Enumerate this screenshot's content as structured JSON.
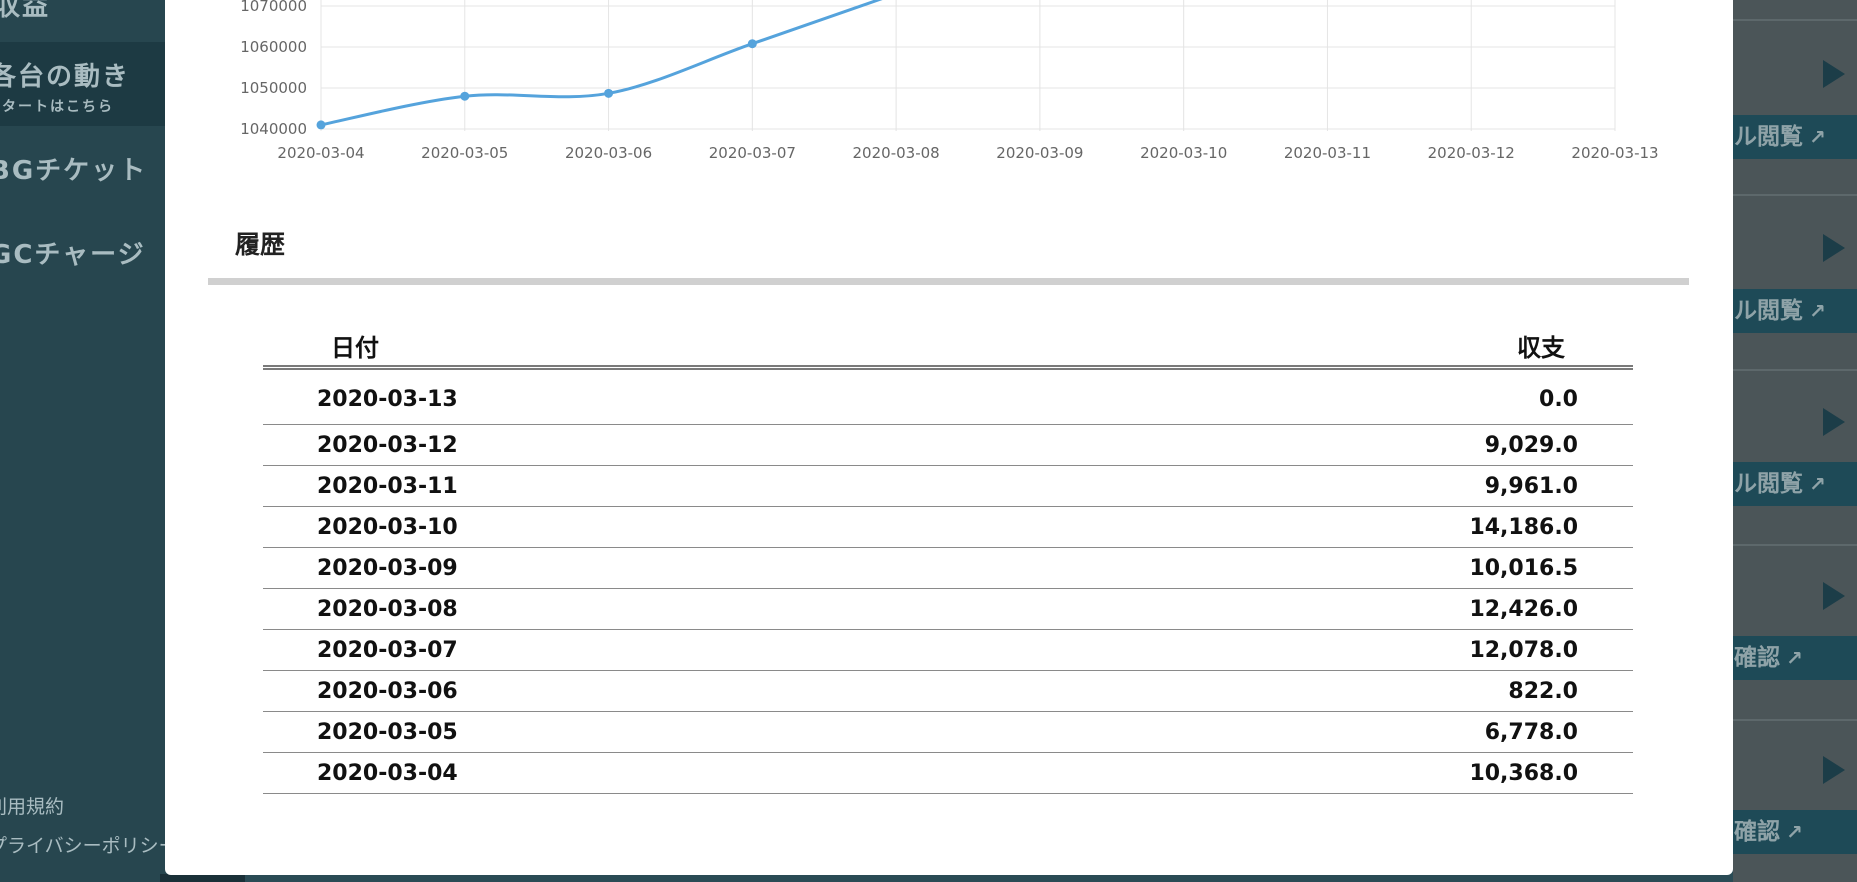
{
  "sidebar": {
    "items": [
      {
        "label": "収益"
      },
      {
        "label": "各台の動き",
        "sub": "スタートはこちら"
      },
      {
        "label": "BGチケット"
      },
      {
        "label": "GCチャージ"
      }
    ],
    "footer": [
      {
        "label": "利用規約"
      },
      {
        "label": "プライバシーポリシー"
      }
    ]
  },
  "background_list": {
    "buttons": [
      {
        "label": "ル閲覧"
      },
      {
        "label": "ル閲覧"
      },
      {
        "label": "ル閲覧"
      },
      {
        "label": "確認"
      },
      {
        "label": "確認"
      }
    ]
  },
  "modal": {
    "history_title": "履歴",
    "table": {
      "headers": {
        "date": "日付",
        "amount": "収支"
      },
      "rows": [
        {
          "date": "2020-03-13",
          "amount": "0.0"
        },
        {
          "date": "2020-03-12",
          "amount": "9,029.0"
        },
        {
          "date": "2020-03-11",
          "amount": "9,961.0"
        },
        {
          "date": "2020-03-10",
          "amount": "14,186.0"
        },
        {
          "date": "2020-03-09",
          "amount": "10,016.5"
        },
        {
          "date": "2020-03-08",
          "amount": "12,426.0"
        },
        {
          "date": "2020-03-07",
          "amount": "12,078.0"
        },
        {
          "date": "2020-03-06",
          "amount": "822.0"
        },
        {
          "date": "2020-03-05",
          "amount": "6,778.0"
        },
        {
          "date": "2020-03-04",
          "amount": "10,368.0"
        }
      ]
    }
  },
  "chart_data": {
    "type": "line",
    "x": [
      "2020-03-04",
      "2020-03-05",
      "2020-03-06",
      "2020-03-07",
      "2020-03-08",
      "2020-03-09",
      "2020-03-10",
      "2020-03-11",
      "2020-03-12",
      "2020-03-13"
    ],
    "y_ticks": [
      "1040000",
      "1050000",
      "1060000",
      "1070000"
    ],
    "series": [
      {
        "values": [
          1041000,
          1048000,
          1048700,
          1060800,
          1073000
        ]
      }
    ],
    "ylim": [
      1040000,
      1070000
    ],
    "grid": true,
    "color": "#55a3dc"
  }
}
